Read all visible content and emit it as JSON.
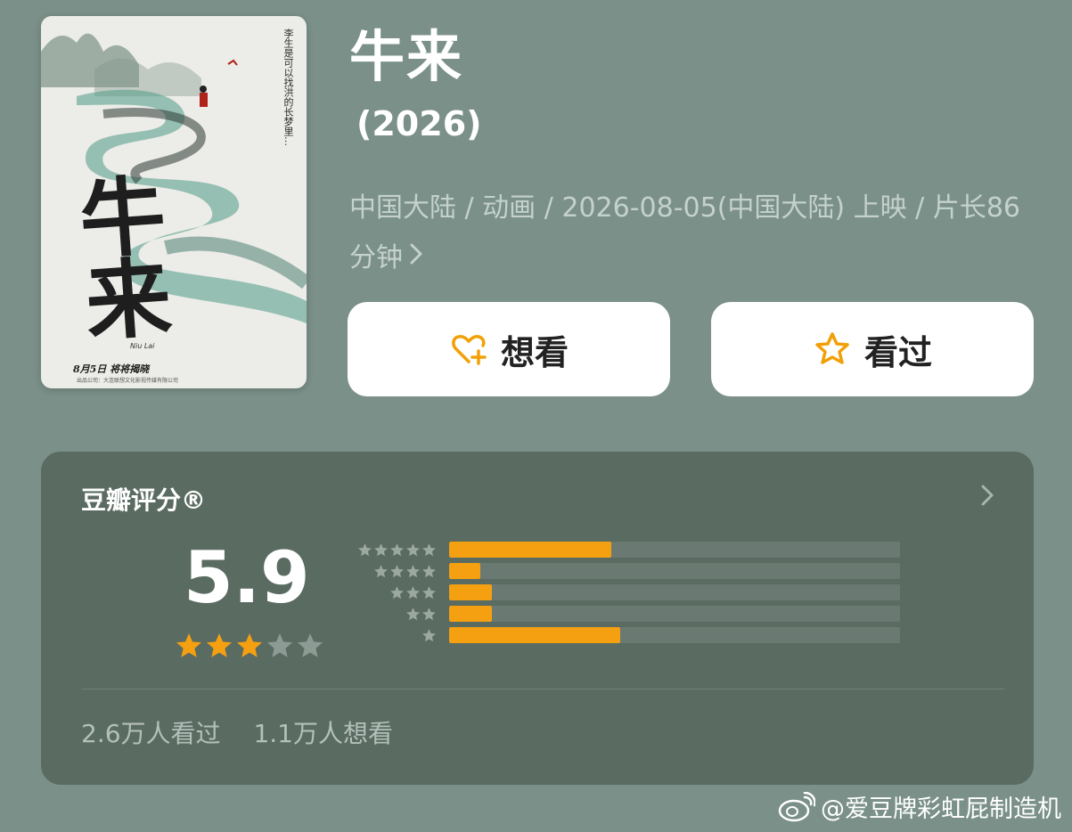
{
  "movie": {
    "title": "牛来",
    "year": "(2026)",
    "meta": "中国大陆 / 动画 / 2026-08-05(中国大陆) 上映 / 片长86分钟",
    "poster": {
      "vertical_text": "李生是可以找洪的长梦里…",
      "big_title": "牛来",
      "english_title": "Niu Lai",
      "release_line": "8月5日  将将揭晓",
      "credit_line": "出品公司：大连联想文化影视传媒有限公司"
    }
  },
  "actions": {
    "want_label": "想看",
    "seen_label": "看过",
    "want_icon": "heart-plus-icon",
    "seen_icon": "star-outline-icon",
    "icon_color": "#f2a007"
  },
  "rating": {
    "header": "豆瓣评分®",
    "score": "5.9",
    "stars_filled": 3,
    "stars_total": 5,
    "distribution": [
      {
        "stars": 5,
        "fraction": 0.36
      },
      {
        "stars": 4,
        "fraction": 0.07
      },
      {
        "stars": 3,
        "fraction": 0.095
      },
      {
        "stars": 2,
        "fraction": 0.095
      },
      {
        "stars": 1,
        "fraction": 0.38
      }
    ],
    "seen_count": "2.6万人看过",
    "want_count": "1.1万人想看",
    "accent": "#f5a011"
  },
  "watermark": {
    "text": "@爱豆牌彩虹屁制造机"
  }
}
